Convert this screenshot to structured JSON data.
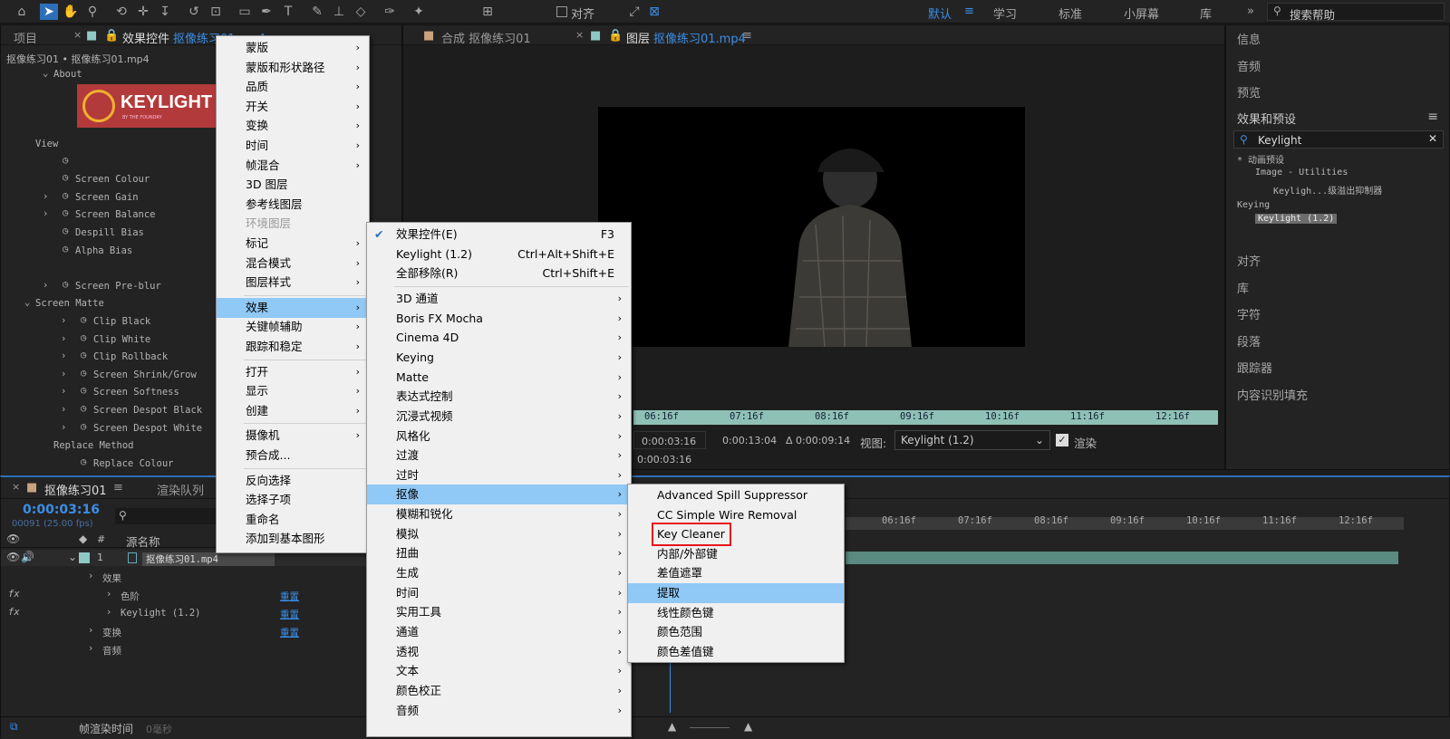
{
  "toolbar": {
    "align_label": "对齐",
    "workspaces": [
      "默认",
      "学习",
      "标准",
      "小屏幕",
      "库"
    ],
    "search_placeholder": "搜索帮助"
  },
  "left_panel": {
    "tab_project": "项目",
    "tab_effects": "效果控件",
    "tab_effects_layer": "抠像练习01.mp4",
    "breadcrumb": "抠像练习01 • 抠像练习01.mp4",
    "logo_text": "KEYLIGHT",
    "logo_sub": "BY THE FOUNDRY",
    "rows": [
      {
        "label": "About",
        "indent": 1,
        "twirl": "down"
      },
      {
        "label": "View",
        "indent": 0
      },
      {
        "label": "",
        "indent": 1,
        "stopwatch": true
      },
      {
        "label": "Screen Colour",
        "indent": 1,
        "stopwatch": true
      },
      {
        "label": "Screen Gain",
        "indent": 1,
        "stopwatch": true,
        "twirl": "right"
      },
      {
        "label": "Screen Balance",
        "indent": 1,
        "stopwatch": true,
        "twirl": "right"
      },
      {
        "label": "Despill Bias",
        "indent": 1,
        "stopwatch": true
      },
      {
        "label": "Alpha Bias",
        "indent": 1,
        "stopwatch": true
      },
      {
        "label": "",
        "indent": 1
      },
      {
        "label": "Screen Pre-blur",
        "indent": 1,
        "stopwatch": true,
        "twirl": "right"
      },
      {
        "label": "Screen Matte",
        "indent": 0,
        "twirl": "down"
      },
      {
        "label": "Clip Black",
        "indent": 2,
        "stopwatch": true,
        "twirl": "right"
      },
      {
        "label": "Clip White",
        "indent": 2,
        "stopwatch": true,
        "twirl": "right"
      },
      {
        "label": "Clip Rollback",
        "indent": 2,
        "stopwatch": true,
        "twirl": "right"
      },
      {
        "label": "Screen Shrink/Grow",
        "indent": 2,
        "stopwatch": true,
        "twirl": "right"
      },
      {
        "label": "Screen Softness",
        "indent": 2,
        "stopwatch": true,
        "twirl": "right"
      },
      {
        "label": "Screen Despot Black",
        "indent": 2,
        "stopwatch": true,
        "twirl": "right"
      },
      {
        "label": "Screen Despot White",
        "indent": 2,
        "stopwatch": true,
        "twirl": "right"
      },
      {
        "label": "Replace Method",
        "indent": 1
      },
      {
        "label": "Replace Colour",
        "indent": 2,
        "stopwatch": true
      }
    ]
  },
  "viewer": {
    "tab_comp": "合成 抠像练习01",
    "tab_layer": "图层",
    "tab_layer_name": "抠像练习01.mp4",
    "ruler_labels": [
      "06:16f",
      "07:16f",
      "08:16f",
      "09:16f",
      "10:16f",
      "11:16f",
      "12:16f"
    ],
    "time_in": "0:00:03:16",
    "time_out": "0:00:13:04",
    "duration": "Δ 0:00:09:14",
    "view_label": "视图:",
    "view_value": "Keylight (1.2)",
    "render_label": "渲染",
    "time_current": "0:00:03:16"
  },
  "right_panel": {
    "items_top": [
      "信息",
      "音频",
      "预览"
    ],
    "effects_title": "效果和预设",
    "search_value": "Keylight",
    "tree": [
      {
        "label": "* 动画预设",
        "indent": 0
      },
      {
        "label": "Image - Utilities",
        "indent": 1
      },
      {
        "label": "Keyligh...级溢出抑制器",
        "indent": 2
      },
      {
        "label": "Keying",
        "indent": 0
      },
      {
        "label": "Keylight (1.2)",
        "indent": 1,
        "selected": true
      }
    ],
    "items_bottom": [
      "对齐",
      "库",
      "字符",
      "段落",
      "跟踪器",
      "内容识别填充"
    ]
  },
  "timeline": {
    "tab_comp": "抠像练习01",
    "tab_render": "渲染队列",
    "timecode": "0:00:03:16",
    "frames": "00091 (25.00 fps)",
    "col_source": "源名称",
    "layer_num": "1",
    "layer_name": "抠像练习01.mp4",
    "rows": [
      {
        "label": "效果",
        "indent": 1
      },
      {
        "label": "色阶",
        "indent": 2,
        "fx": true,
        "value": "重置"
      },
      {
        "label": "Keylight (1.2)",
        "indent": 2,
        "fx": true,
        "value": "重置"
      },
      {
        "label": "变换",
        "indent": 1,
        "value": "重置"
      },
      {
        "label": "音频",
        "indent": 1
      }
    ],
    "ruler_labels": [
      "06:16f",
      "07:16f",
      "08:16f",
      "09:16f",
      "10:16f",
      "11:16f",
      "12:16f"
    ],
    "status_label": "帧渲染时间",
    "status_value": "0毫秒"
  },
  "menu_main": {
    "items": [
      {
        "label": "蒙版",
        "arrow": true
      },
      {
        "label": "蒙版和形状路径",
        "arrow": true
      },
      {
        "label": "品质",
        "arrow": true
      },
      {
        "label": "开关",
        "arrow": true
      },
      {
        "label": "变换",
        "arrow": true
      },
      {
        "label": "时间",
        "arrow": true
      },
      {
        "label": "帧混合",
        "arrow": true
      },
      {
        "label": "3D 图层"
      },
      {
        "label": "参考线图层"
      },
      {
        "label": "环境图层",
        "disabled": true
      },
      {
        "label": "标记",
        "arrow": true
      },
      {
        "label": "混合模式",
        "arrow": true
      },
      {
        "label": "图层样式",
        "arrow": true
      },
      {
        "sep": true
      },
      {
        "label": "效果",
        "arrow": true,
        "selected": true
      },
      {
        "label": "关键帧辅助",
        "arrow": true
      },
      {
        "label": "跟踪和稳定",
        "arrow": true
      },
      {
        "sep": true
      },
      {
        "label": "打开",
        "arrow": true
      },
      {
        "label": "显示",
        "arrow": true
      },
      {
        "label": "创建",
        "arrow": true
      },
      {
        "sep": true
      },
      {
        "label": "摄像机",
        "arrow": true
      },
      {
        "label": "预合成..."
      },
      {
        "sep": true
      },
      {
        "label": "反向选择"
      },
      {
        "label": "选择子项"
      },
      {
        "label": "重命名"
      },
      {
        "label": "添加到基本图形"
      }
    ]
  },
  "menu_effects": {
    "items": [
      {
        "label": "效果控件(E)",
        "shortcut": "F3",
        "checked": true
      },
      {
        "label": "Keylight (1.2)",
        "shortcut": "Ctrl+Alt+Shift+E"
      },
      {
        "label": "全部移除(R)",
        "shortcut": "Ctrl+Shift+E"
      },
      {
        "sep": true
      },
      {
        "label": "3D 通道",
        "arrow": true
      },
      {
        "label": "Boris FX Mocha",
        "arrow": true
      },
      {
        "label": "Cinema 4D",
        "arrow": true
      },
      {
        "label": "Keying",
        "arrow": true
      },
      {
        "label": "Matte",
        "arrow": true
      },
      {
        "label": "表达式控制",
        "arrow": true
      },
      {
        "label": "沉浸式视频",
        "arrow": true
      },
      {
        "label": "风格化",
        "arrow": true
      },
      {
        "label": "过渡",
        "arrow": true
      },
      {
        "label": "过时",
        "arrow": true
      },
      {
        "label": "抠像",
        "arrow": true,
        "selected": true
      },
      {
        "label": "模糊和锐化",
        "arrow": true
      },
      {
        "label": "模拟",
        "arrow": true
      },
      {
        "label": "扭曲",
        "arrow": true
      },
      {
        "label": "生成",
        "arrow": true
      },
      {
        "label": "时间",
        "arrow": true
      },
      {
        "label": "实用工具",
        "arrow": true
      },
      {
        "label": "通道",
        "arrow": true
      },
      {
        "label": "透视",
        "arrow": true
      },
      {
        "label": "文本",
        "arrow": true
      },
      {
        "label": "颜色校正",
        "arrow": true
      },
      {
        "label": "音频",
        "arrow": true
      }
    ]
  },
  "menu_keying": {
    "items": [
      {
        "label": "Advanced Spill Suppressor"
      },
      {
        "label": "CC Simple Wire Removal"
      },
      {
        "label": "Key Cleaner",
        "highlight": true
      },
      {
        "label": "内部/外部键"
      },
      {
        "label": "差值遮罩"
      },
      {
        "label": "提取",
        "selected": true
      },
      {
        "label": "线性颜色键"
      },
      {
        "label": "颜色范围"
      },
      {
        "label": "颜色差值键"
      }
    ],
    "highlight_color": "#e8141e"
  }
}
